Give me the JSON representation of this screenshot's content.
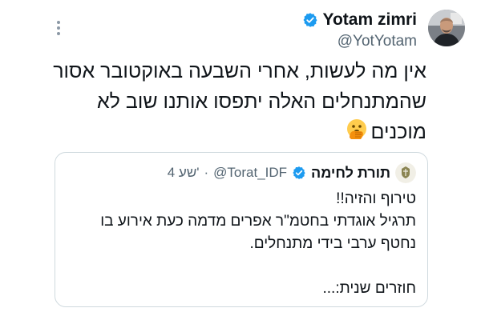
{
  "author": {
    "display_name": "Yotam zimri",
    "handle": "@YotYotam",
    "verified": true,
    "verified_color": "#1d9bf0"
  },
  "tweet": {
    "lines": [
      "אין מה לעשות, אחרי השבעה באוקטובר אסור",
      "שהמתנחלים האלה יתפסו אותנו שוב לא",
      "מוכנים"
    ],
    "emoji": "face-with-open-eyes-and-hand-over-mouth"
  },
  "quoted_tweet": {
    "display_name": "תורת לחימה",
    "handle": "@Torat_IDF",
    "time": "4 שע'",
    "verified": true,
    "lines": [
      "טירוף והזיה!!",
      "תרגיל אוגדתי בחטמ\"ר אפרים מדמה כעת אירוע בו",
      "נחטף ערבי בידי מתנחלים.",
      "",
      "חוזרים שנית:..."
    ]
  },
  "icons": {
    "more": "more-options-icon",
    "verified": "verified-badge-icon"
  }
}
